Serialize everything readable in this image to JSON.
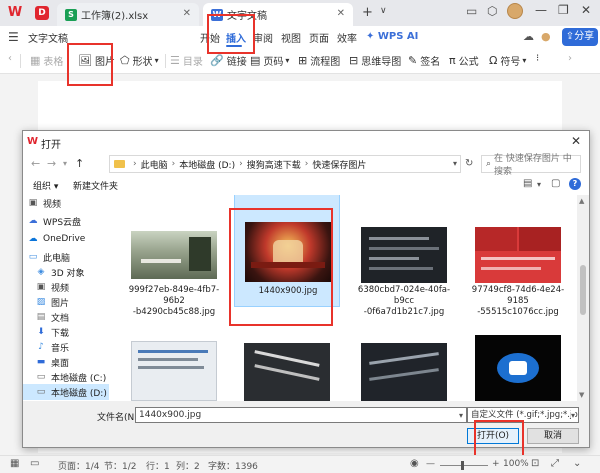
{
  "tabbar": {
    "tabs": [
      {
        "label": "工作簿(2).xlsx",
        "icon": "S"
      },
      {
        "label": "文字文稿",
        "icon": "W"
      }
    ],
    "new_tab_label": "+",
    "new_tab_dropdown": "∨"
  },
  "menubar": {
    "app_menu": "文字文稿",
    "items": [
      "开始",
      "插入",
      "审阅",
      "视图",
      "页面",
      "效率"
    ],
    "active": "插入",
    "ai_label": "WPS AI",
    "share_label": "分享"
  },
  "toolbar": {
    "items": [
      {
        "label": "表格",
        "icon": "table-icon",
        "disabled": true
      },
      {
        "label": "图片",
        "icon": "image-icon",
        "disabled": false
      },
      {
        "label": "形状",
        "icon": "shape-icon",
        "disabled": false
      },
      {
        "label": "目录",
        "icon": "toc-icon",
        "disabled": true
      },
      {
        "label": "链接",
        "icon": "link-icon",
        "disabled": false
      },
      {
        "label": "页码",
        "icon": "page-number-icon",
        "disabled": false
      },
      {
        "label": "流程图",
        "icon": "flowchart-icon",
        "disabled": false
      },
      {
        "label": "思维导图",
        "icon": "mindmap-icon",
        "disabled": false
      },
      {
        "label": "签名",
        "icon": "signature-icon",
        "disabled": false
      },
      {
        "label": "公式",
        "icon": "formula-icon",
        "disabled": false
      },
      {
        "label": "符号",
        "icon": "symbol-icon",
        "disabled": false
      }
    ]
  },
  "dialog": {
    "title": "打开",
    "path": [
      "此电脑",
      "本地磁盘 (D:)",
      "搜狗高速下载",
      "快速保存图片"
    ],
    "search_placeholder": "在 快速保存图片 中搜索",
    "organize_label": "组织 ▾",
    "new_folder_label": "新建文件夹",
    "sidebar": [
      {
        "label": "视频",
        "icon": "video-icon"
      },
      {
        "label": "WPS云盘",
        "icon": "cloud-icon"
      },
      {
        "label": "OneDrive",
        "icon": "onedrive-icon"
      },
      {
        "label": "此电脑",
        "icon": "pc-icon"
      },
      {
        "label": "3D 对象",
        "icon": "3d-icon"
      },
      {
        "label": "视频",
        "icon": "video-icon"
      },
      {
        "label": "图片",
        "icon": "picture-icon"
      },
      {
        "label": "文档",
        "icon": "document-icon"
      },
      {
        "label": "下载",
        "icon": "download-icon"
      },
      {
        "label": "音乐",
        "icon": "music-icon"
      },
      {
        "label": "桌面",
        "icon": "desktop-icon"
      },
      {
        "label": "本地磁盘 (C:)",
        "icon": "drive-icon"
      },
      {
        "label": "本地磁盘 (D:)",
        "icon": "drive-icon"
      },
      {
        "label": "网络",
        "icon": "network-icon"
      }
    ],
    "files": [
      {
        "label": "999f27eb-849e-4fb7-96b2-b4290cb45c88.jpg",
        "line1": "999f27eb-849e-4fb7-96b2",
        "line2": "-b4290cb45c88.jpg",
        "selected": false
      },
      {
        "label": "1440x900.jpg",
        "line1": "1440x900.jpg",
        "line2": "",
        "selected": true
      },
      {
        "label": "6380cbd7-024e-40fa-b9cc-0f6a7d1b21c7.jpg",
        "line1": "6380cbd7-024e-40fa-b9cc",
        "line2": "-0f6a7d1b21c7.jpg",
        "selected": false
      },
      {
        "label": "97749cf8-74d6-4e24-9185-55515c1076cc.jpg",
        "line1": "97749cf8-74d6-4e24-9185",
        "line2": "-55515c1076cc.jpg",
        "selected": false
      },
      {
        "label": "",
        "line1": "",
        "line2": "",
        "selected": false
      },
      {
        "label": "",
        "line1": "",
        "line2": "",
        "selected": false
      },
      {
        "label": "",
        "line1": "",
        "line2": "",
        "selected": false
      },
      {
        "label": "",
        "line1": "",
        "line2": "",
        "selected": false
      }
    ],
    "filename_label": "文件名(N):",
    "filename_value": "1440x900.jpg",
    "filetype_value": "自定义文件 (*.gif;*.jpg;*.jpeg;",
    "open_label": "打开(O)",
    "cancel_label": "取消"
  },
  "statusbar": {
    "page": "页面：1/4",
    "section": "节：1/2",
    "row": "行：1",
    "col": "列：2",
    "words": "字数：1396",
    "zoom": "100%",
    "zoom_out": "—",
    "zoom_in": "+"
  },
  "colors": {
    "accent": "#2f6bd8",
    "annotation_red": "#e8332b",
    "selection": "#cce8ff"
  }
}
